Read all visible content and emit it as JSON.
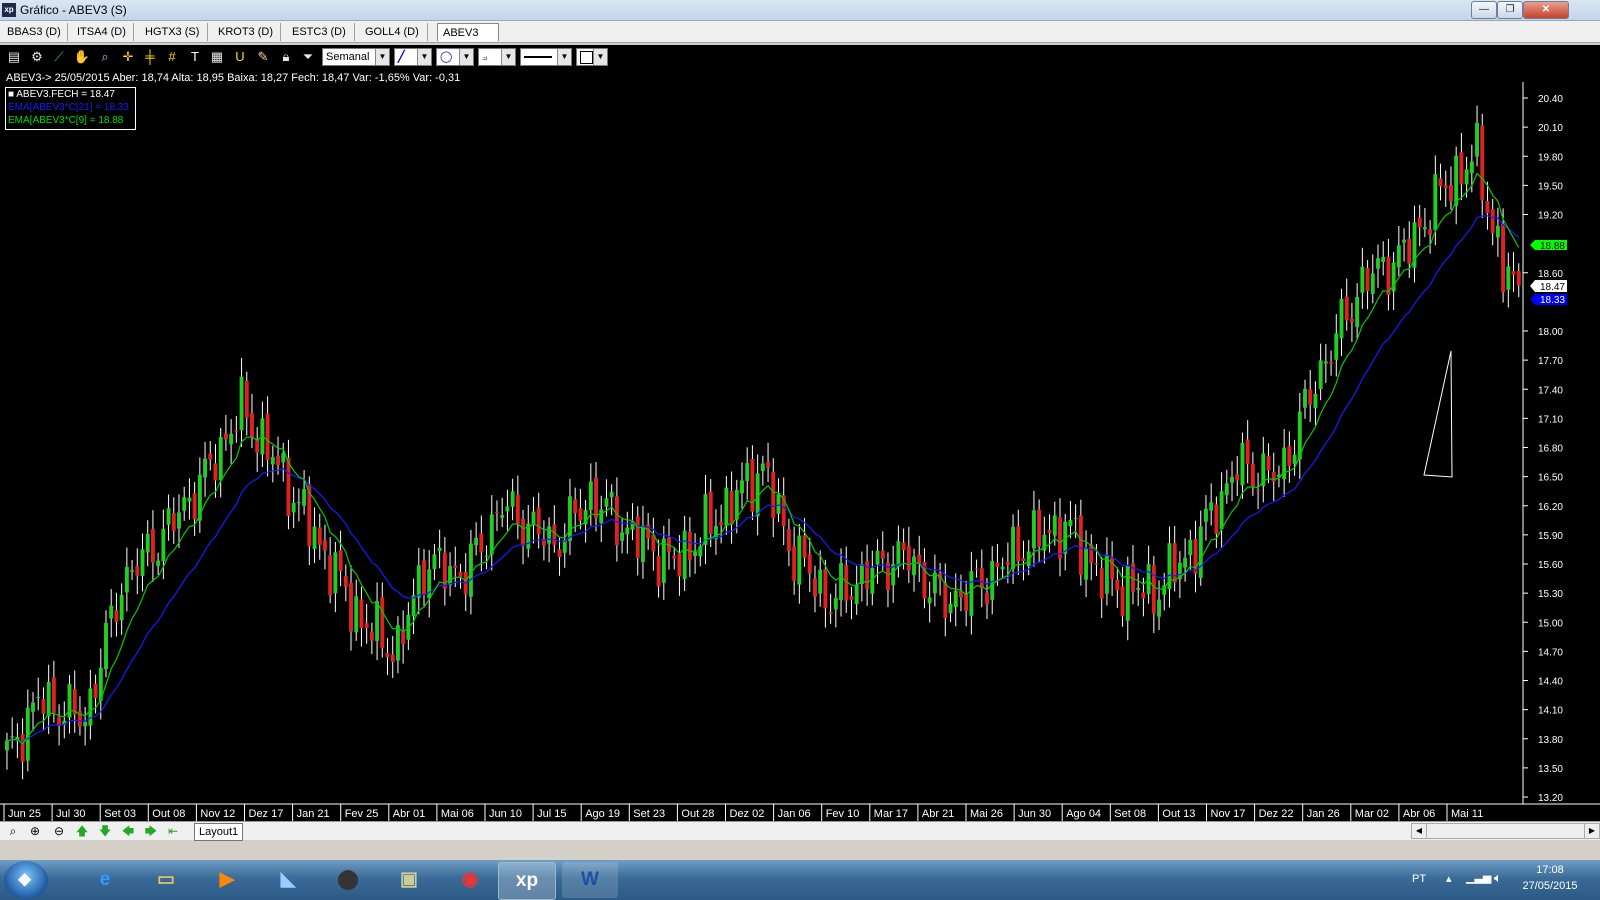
{
  "window": {
    "title": "Gráfico - ABEV3 (S)",
    "app_icon": "xp",
    "minimize": "—",
    "maximize": "❐",
    "close": "✕"
  },
  "tabs": [
    {
      "label": "BBAS3 (D)"
    },
    {
      "label": "ITSA4 (D)"
    },
    {
      "label": "HGTX3 (S)"
    },
    {
      "label": "KROT3 (D)"
    },
    {
      "label": "ESTC3 (D)"
    },
    {
      "label": "GOLL4 (D)"
    },
    {
      "label": "ABEV3 (S)"
    }
  ],
  "toolbar": {
    "period": "Semanal"
  },
  "info": {
    "line": "ABEV3-> 25/05/2015 Aber: 18,74 Alta: 18,95 Baixa: 18,27 Fech: 18,47 Var: -1,65% Var: -0,31"
  },
  "legend": {
    "close": "■ ABEV3.FECH = 18.47",
    "ema21": "EMA[ABEV3*C[21] = 18.33",
    "ema9": "EMA[ABEV3*C[9] = 18.88"
  },
  "colors": {
    "up": "#22cc22",
    "down": "#dd2222",
    "ema9": "#00cc00",
    "ema21": "#1a1aff",
    "background": "#000000"
  },
  "chart_data": {
    "type": "candlestick",
    "period": "Semanal",
    "y_ticks": [
      "20.40",
      "20.10",
      "19.80",
      "19.50",
      "19.20",
      "18.60",
      "18.00",
      "17.70",
      "17.40",
      "17.10",
      "16.80",
      "16.50",
      "16.20",
      "15.90",
      "15.60",
      "15.30",
      "15.00",
      "14.70",
      "14.40",
      "14.10",
      "13.80",
      "13.50",
      "13.20"
    ],
    "x_labels": [
      "Jun 25",
      "Jul 30",
      "Set 03",
      "Out 08",
      "Nov 12",
      "Dez 17",
      "Jan 21",
      "Fev 25",
      "Abr 01",
      "Mai 06",
      "Jun 10",
      "Jul 15",
      "Ago 19",
      "Set 23",
      "Out 28",
      "Dez 02",
      "Jan 06",
      "Fev 10",
      "Mar 17",
      "Abr 21",
      "Mai 26",
      "Jun 30",
      "Ago 04",
      "Set 08",
      "Out 13",
      "Nov 17",
      "Dez 22",
      "Jan 26",
      "Mar 02",
      "Abr 06",
      "Mai 11"
    ],
    "last_values": {
      "ema9": "18.88",
      "close": "18.47",
      "ema21": "18.33"
    },
    "ylim": [
      13.1,
      20.6
    ]
  }
}
